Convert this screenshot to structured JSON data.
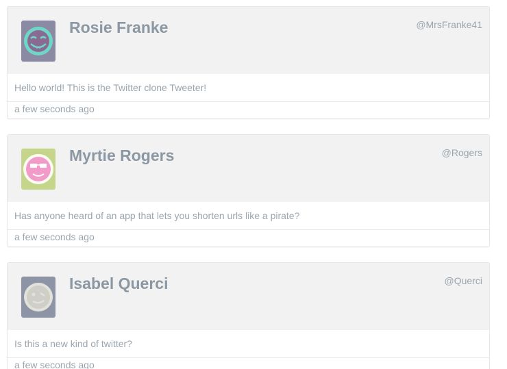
{
  "tweets": [
    {
      "name": "Rosie Franke",
      "handle": "@MrsFranke41",
      "content": "Hello world! This is the Twitter clone Tweeter!",
      "time": "a few seconds ago",
      "avatar_icon": "grinning-face-icon",
      "avatar_bg": "#8a8aa5",
      "avatar_accent": "#6ed7c8"
    },
    {
      "name": "Myrtie Rogers",
      "handle": "@Rogers",
      "content": "Has anyone heard of an app that lets you shorten urls like a pirate?",
      "time": "a few seconds ago",
      "avatar_icon": "sunglasses-face-icon",
      "avatar_bg": "#c5d68a",
      "avatar_accent": "#f29ac8"
    },
    {
      "name": "Isabel Querci",
      "handle": "@Querci",
      "content": "Is this a new kind of twitter?",
      "time": "a few seconds ago",
      "avatar_icon": "winking-face-icon",
      "avatar_bg": "#8d94a6",
      "avatar_accent": "#d6d6cf"
    }
  ]
}
